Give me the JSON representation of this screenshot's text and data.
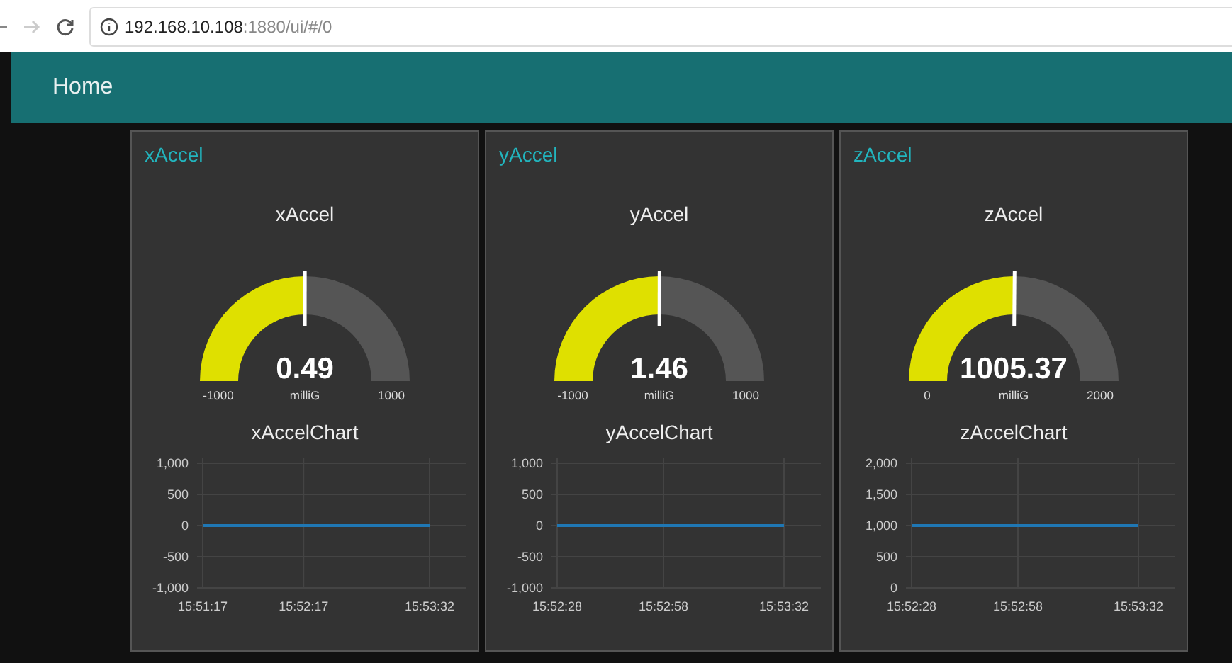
{
  "browser": {
    "url_host": "192.168.10.108",
    "url_path": ":1880/ui/#/0"
  },
  "header": {
    "title": "Home"
  },
  "cards": [
    {
      "title": "xAccel",
      "gauge": {
        "title": "xAccel",
        "value": "0.49",
        "units": "milliG",
        "min": "-1000",
        "max": "1000"
      },
      "chart": {
        "title": "xAccelChart",
        "chart_data": {
          "type": "line",
          "grid": true,
          "categories": [
            "15:51:17",
            null,
            null,
            null,
            "15:52:17",
            null,
            null,
            null,
            null,
            "15:53:32"
          ],
          "ylim": [
            -1000,
            1000
          ],
          "yticks": [
            {
              "value": 1000,
              "label": "1,000"
            },
            {
              "value": 500,
              "label": "500"
            },
            {
              "value": 0,
              "label": "0"
            },
            {
              "value": -500,
              "label": "-500"
            },
            {
              "value": -1000,
              "label": "-1,000"
            }
          ],
          "series": [
            {
              "color": "#1f77b4",
              "values": [
                0,
                0,
                0,
                0,
                0,
                0,
                0,
                0,
                0,
                0
              ]
            }
          ]
        }
      }
    },
    {
      "title": "yAccel",
      "gauge": {
        "title": "yAccel",
        "value": "1.46",
        "units": "milliG",
        "min": "-1000",
        "max": "1000"
      },
      "chart": {
        "title": "yAccelChart",
        "chart_data": {
          "type": "line",
          "grid": true,
          "categories": [
            "15:52:28",
            null,
            null,
            null,
            null,
            null,
            null,
            null,
            null,
            null,
            null,
            null,
            null,
            null,
            null,
            "15:52:58",
            null,
            null,
            null,
            null,
            null,
            null,
            null,
            null,
            null,
            null,
            null,
            null,
            null,
            null,
            null,
            null,
            "15:53:32"
          ],
          "ylim": [
            -1000,
            1000
          ],
          "yticks": [
            {
              "value": 1000,
              "label": "1,000"
            },
            {
              "value": 500,
              "label": "500"
            },
            {
              "value": 0,
              "label": "0"
            },
            {
              "value": -500,
              "label": "-500"
            },
            {
              "value": -1000,
              "label": "-1,000"
            }
          ],
          "series": [
            {
              "color": "#1f77b4",
              "values": [
                0,
                0,
                0,
                0,
                0,
                0,
                0,
                0,
                0,
                0,
                0,
                0,
                0,
                0,
                0,
                0,
                0,
                0,
                0,
                0,
                0,
                0,
                0,
                0,
                0,
                0,
                0,
                0,
                0,
                0,
                0,
                0,
                0
              ]
            }
          ]
        }
      }
    },
    {
      "title": "zAccel",
      "gauge": {
        "title": "zAccel",
        "value": "1005.37",
        "units": "milliG",
        "min": "0",
        "max": "2000"
      },
      "chart": {
        "title": "zAccelChart",
        "chart_data": {
          "type": "line",
          "grid": true,
          "categories": [
            "15:52:28",
            null,
            null,
            null,
            null,
            null,
            null,
            null,
            null,
            null,
            null,
            null,
            null,
            null,
            null,
            "15:52:58",
            null,
            null,
            null,
            null,
            null,
            null,
            null,
            null,
            null,
            null,
            null,
            null,
            null,
            null,
            null,
            null,
            "15:53:32"
          ],
          "ylim": [
            0,
            2000
          ],
          "yticks": [
            {
              "value": 2000,
              "label": "2,000"
            },
            {
              "value": 1500,
              "label": "1,500"
            },
            {
              "value": 1000,
              "label": "1,000"
            },
            {
              "value": 500,
              "label": "500"
            },
            {
              "value": 0,
              "label": "0"
            }
          ],
          "series": [
            {
              "color": "#1f77b4",
              "values": [
                1000,
                1000,
                1000,
                1000,
                1000,
                1000,
                1000,
                1000,
                1000,
                1000,
                1000,
                1000,
                1000,
                1000,
                1000,
                1000,
                1000,
                1000,
                1000,
                1000,
                1000,
                1000,
                1000,
                1000,
                1000,
                1000,
                1000,
                1000,
                1000,
                1000,
                1000,
                1000,
                1000
              ]
            }
          ]
        }
      }
    }
  ]
}
